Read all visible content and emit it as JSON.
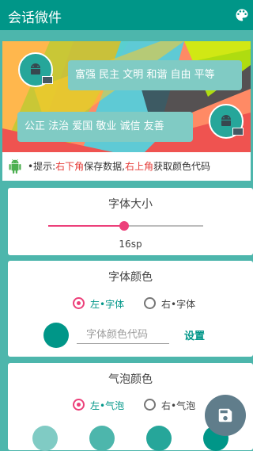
{
  "appbar": {
    "title": "会话微件",
    "menu_icon": "palette-icon"
  },
  "preview": {
    "bubble_right": "富强 民主 文明 和谐 自由 平等",
    "bubble_left": "公正 法治 爱国 敬业 诚信 友善"
  },
  "hint": {
    "prefix": "•提示:",
    "bottom_right": "右下角",
    "mid": "保存数据,",
    "top_right": "右上角",
    "suffix": "获取颜色代码"
  },
  "font_size_card": {
    "title": "字体大小",
    "value": "16sp",
    "slider_fraction": 0.49
  },
  "font_color_card": {
    "title": "字体颜色",
    "option_left": "左•字体",
    "option_right": "右•字体",
    "selected": "left",
    "input_placeholder": "字体颜色代码",
    "input_value": "",
    "set_label": "设置",
    "swatch_color": "#009688"
  },
  "bubble_color_card": {
    "title": "气泡颜色",
    "option_left": "左•气泡",
    "option_right": "右•气泡",
    "selected": "left",
    "swatch_colors": [
      "#80cbc4",
      "#4db6ac",
      "#26a69a",
      "#009688"
    ]
  },
  "fab": {
    "icon": "save-icon",
    "color": "#607d8b"
  },
  "colors": {
    "primary": "#009688",
    "accent": "#ec407a",
    "background": "#4db6ac"
  }
}
